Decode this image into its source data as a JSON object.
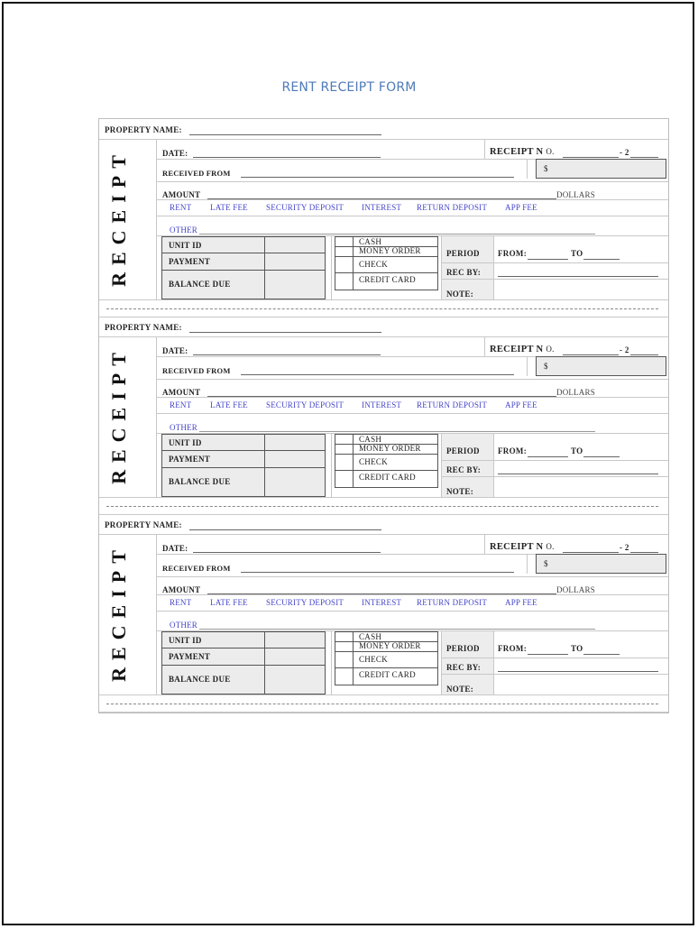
{
  "title": "RENT RECEIPT FORM",
  "receipt_template": {
    "property_name_label": "PROPERTY NAME:",
    "vertical_label": "RECEIPT",
    "date_label": "DATE:",
    "receipt_no_label": "RECEIPT N",
    "receipt_no_suffix_label": "O.",
    "receipt_no_dash": "- 2",
    "received_from_label": "RECEIVED FROM",
    "dollar_sign": "$",
    "amount_label": "AMOUNT",
    "dollars_label": "DOLLARS",
    "categories": [
      "RENT",
      "LATE FEE",
      "SECURITY DEPOSIT",
      "INTEREST",
      "RETURN DEPOSIT",
      "APP FEE"
    ],
    "other_label": "OTHER",
    "summary_rows": [
      "UNIT ID",
      "PAYMENT",
      "BALANCE DUE"
    ],
    "payment_methods": [
      "CASH",
      "MONEY ORDER",
      "CHECK",
      "CREDIT CARD"
    ],
    "period_label": "PERIOD",
    "from_label": "FROM:",
    "to_label": "TO",
    "rec_by_label": "REC BY:",
    "note_label": "NOTE:"
  },
  "receipts": [
    {
      "index": 1
    },
    {
      "index": 2
    },
    {
      "index": 3
    }
  ],
  "colors": {
    "title": "#4f7ab8",
    "category_text": "#4545c8",
    "shaded_cell": "#ececec"
  }
}
